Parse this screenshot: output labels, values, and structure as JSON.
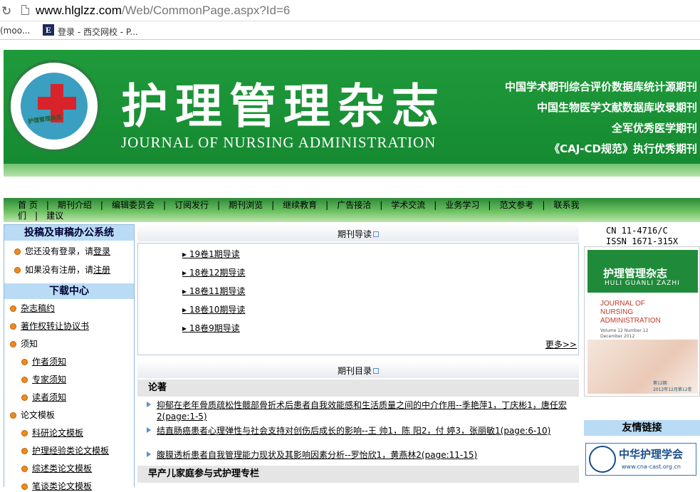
{
  "browser": {
    "url_host": "www.hlglzz.com",
    "url_path": "/Web/CommonPage.aspx?Id=6",
    "bookmarks": [
      "(moo...",
      "登录 - 西交网校 - P..."
    ],
    "bookmark_icon_letter": "E"
  },
  "banner": {
    "title_cn": "护理管理杂志",
    "title_en": "JOURNAL OF NURSING ADMINISTRATION",
    "logo_ring_text": "护理管理杂志",
    "claims": [
      "中国学术期刊综合评价数据库统计源期刊",
      "中国生物医学文献数据库收录期刊",
      "全军优秀医学期刊",
      "《CAJ-CD规范》执行优秀期刊"
    ]
  },
  "nav": {
    "row1": [
      "首 页",
      "期刊介绍",
      "编辑委员会",
      "订阅发行",
      "期刊浏览",
      "继续教育",
      "广告接洽",
      "学术交流",
      "业务学习",
      "范文参考",
      "联系我"
    ],
    "row2": [
      "们",
      "建议"
    ]
  },
  "left": {
    "submit_title": "投稿及审稿办公系统",
    "login_prefix": "您还没有登录，请",
    "login_link": "登录",
    "register_prefix": "如果没有注册，请",
    "register_link": "注册",
    "download_title": "下载中心",
    "items": [
      "杂志稿约",
      "著作权转让协议书",
      "须知",
      "作者须知",
      "专家须知",
      "读者须知",
      "论文模板",
      "科研论文模板",
      "护理经验类论文模板",
      "综述类论文模板",
      "笔谈类论文模板"
    ]
  },
  "center": {
    "guide_title": "期刊导读",
    "guide_links": [
      "19卷1期导读",
      "18卷12期导读",
      "18卷11期导读",
      "18卷10期导读",
      "18卷9期导读"
    ],
    "more": "更多>>",
    "toc_title": "期刊目录",
    "category1": "论著",
    "articles": [
      "抑郁在老年骨质疏松性髋部骨折术后患者自我效能感和生活质量之间的中介作用--季艳萍1，丁庆彬1，唐任宏2(page:1-5)",
      "结直肠癌患者心理弹性与社会支持对创伤后成长的影响--王 帅1，陈 阳2，付 婷3，张丽敏1(page:6-10)",
      "腹膜透析患者自我管理能力现状及其影响因素分析--罗怡欣1，黄燕林2(page:11-15)"
    ],
    "category2": "早产儿家庭参与式护理专栏"
  },
  "right": {
    "cn": "CN 11-4716/C",
    "issn": "ISSN 1671-315X",
    "cover_cn": "护理管理杂志",
    "cover_pinyin": "HULI GUANLI ZAZHI",
    "cover_en": [
      "JOURNAL OF",
      "NURSING",
      "ADMINISTRATION"
    ],
    "cover_vol": [
      "Volume 12  Number 12",
      "December  2012"
    ],
    "cover_issue": "第12期",
    "cover_date": "2012年12月第12卷",
    "links_title": "友情链接",
    "cna_name": "中华护理学会",
    "cna_url": "www.cna-cast.org.cn"
  }
}
